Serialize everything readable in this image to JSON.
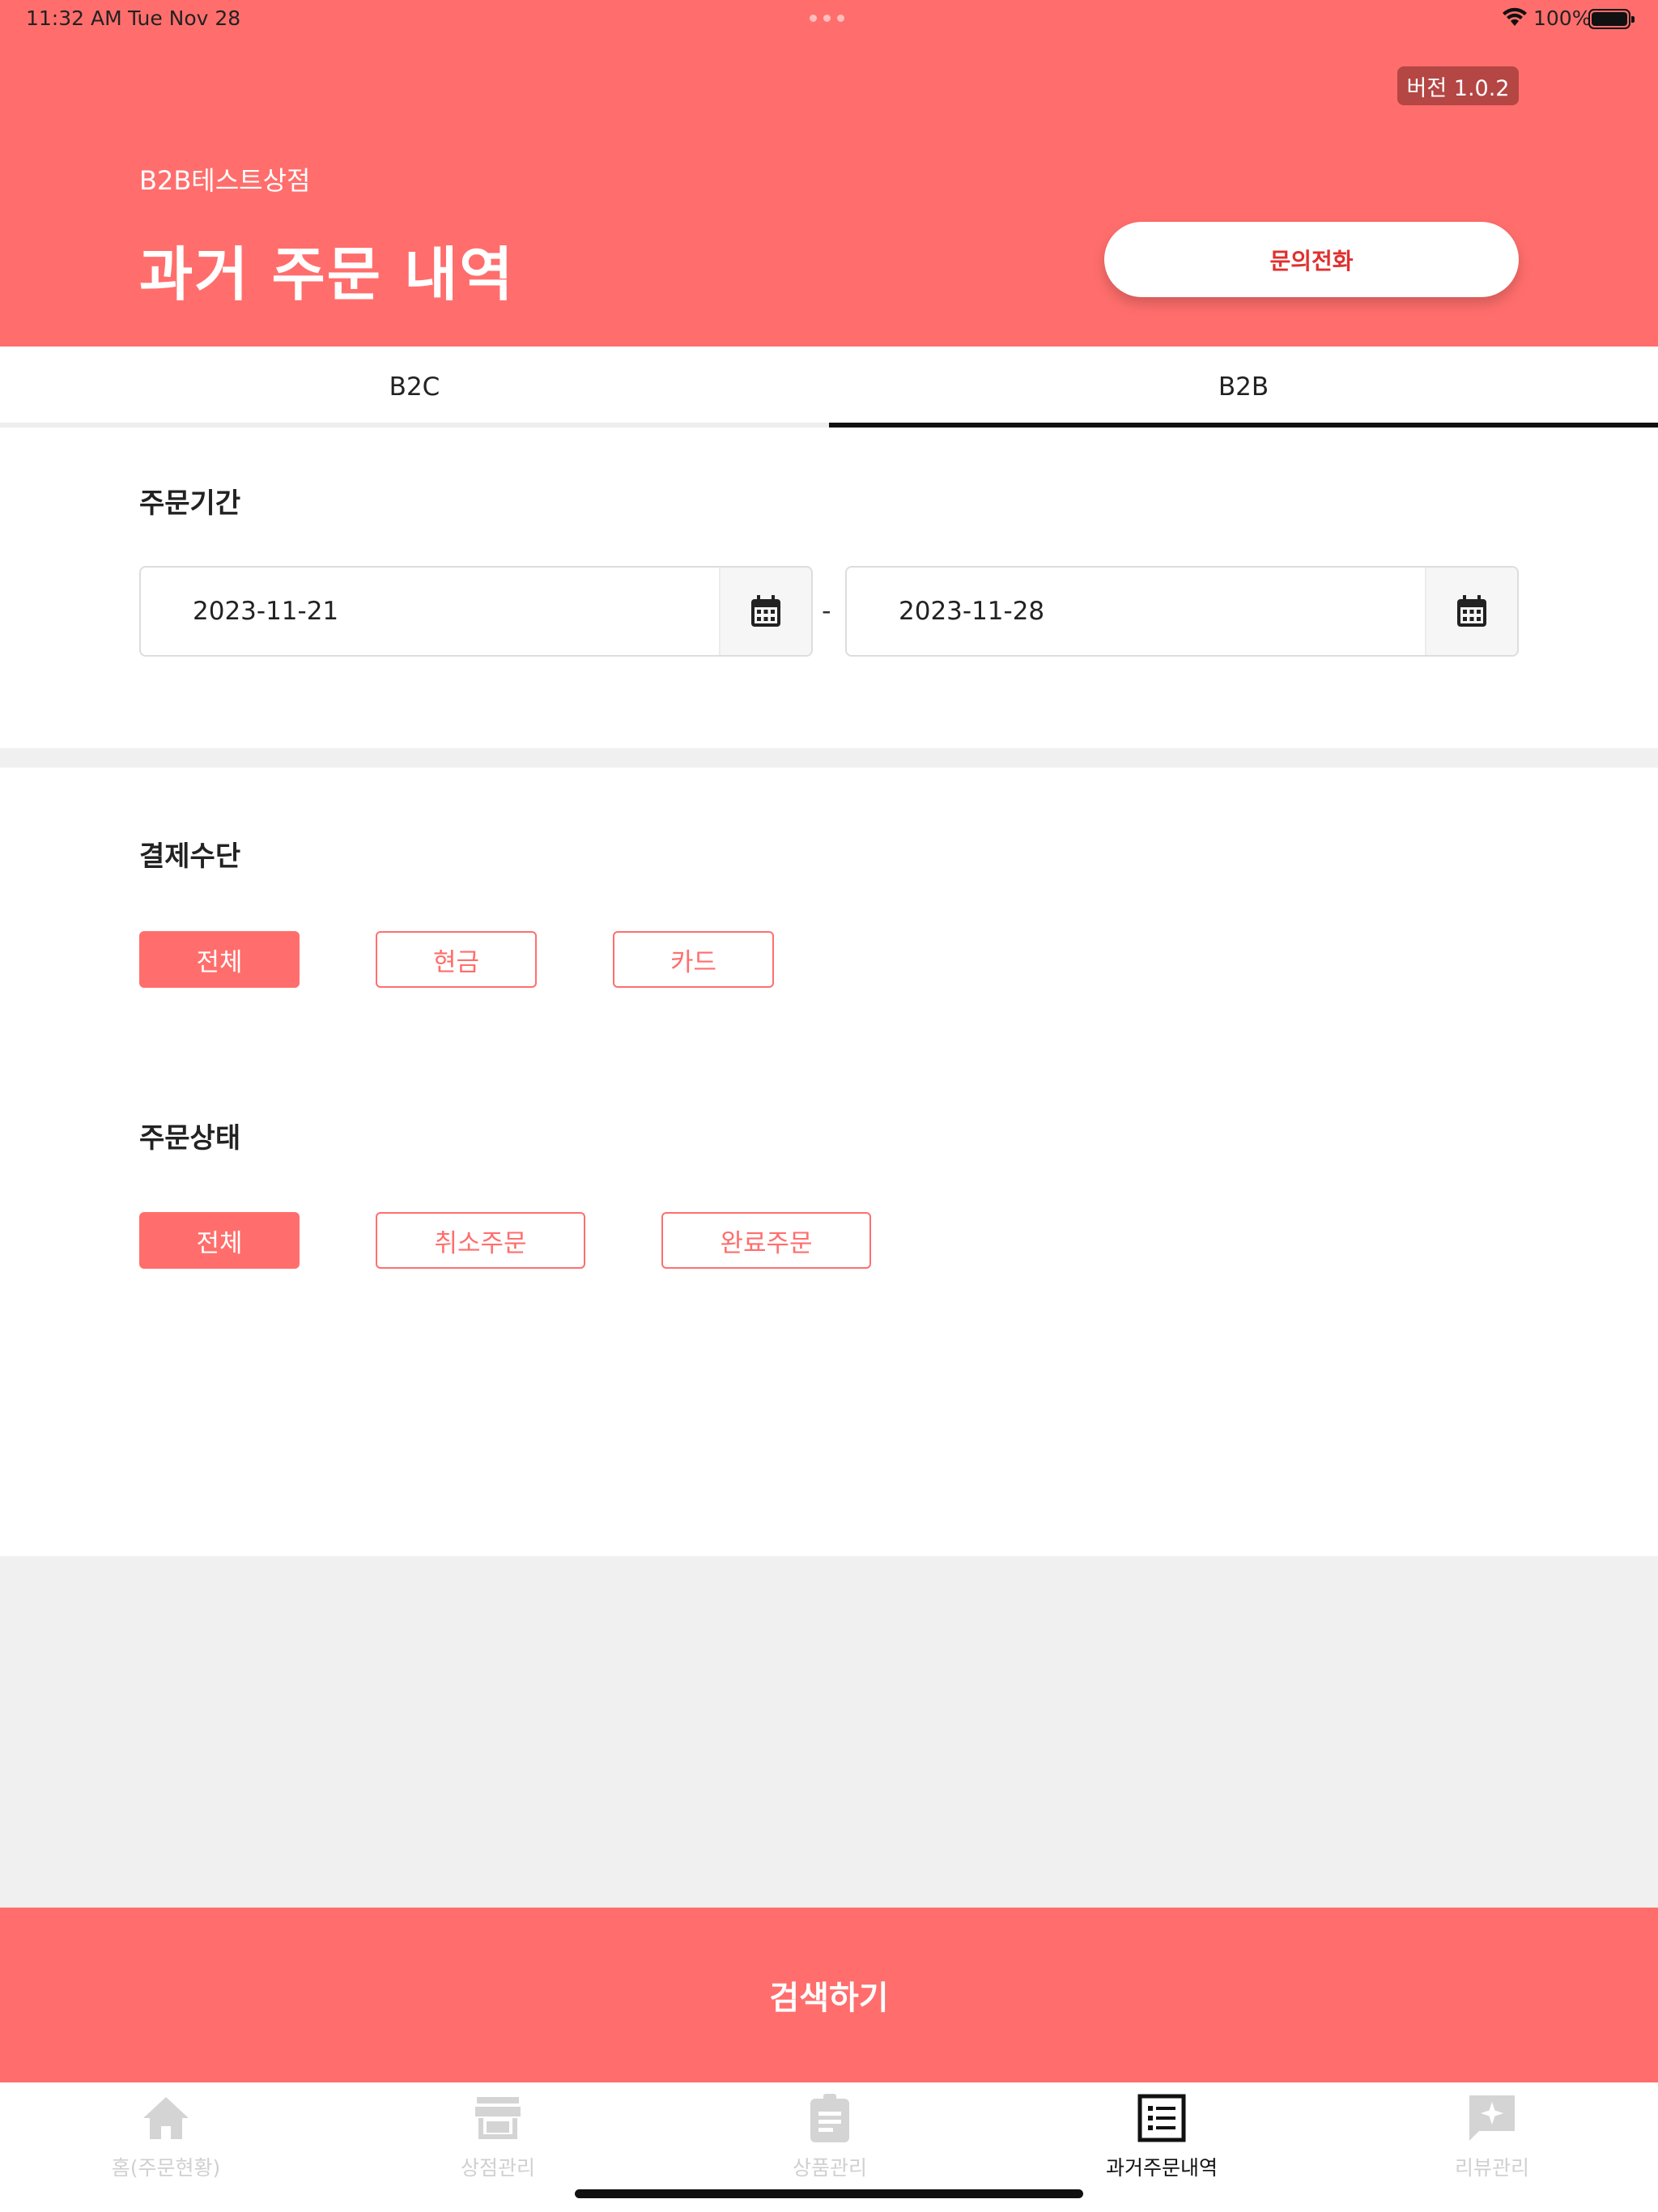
{
  "status_bar": {
    "time": "11:32 AM",
    "date": "Tue Nov 28",
    "battery": "100%"
  },
  "header": {
    "version": "버전 1.0.2",
    "store_name": "B2B테스트상점",
    "title": "과거 주문 내역",
    "call_button": "문의전화",
    "brand_color": "#ff6e6c"
  },
  "tabs": {
    "items": [
      "B2C",
      "B2B"
    ],
    "active": "B2B"
  },
  "period": {
    "label": "주문기간",
    "start_date": "2023-11-21",
    "separator": "-",
    "end_date": "2023-11-28"
  },
  "payment": {
    "label": "결제수단",
    "options": [
      "전체",
      "현금",
      "카드"
    ],
    "selected": "전체"
  },
  "status": {
    "label": "주문상태",
    "options": [
      "전체",
      "취소주문",
      "완료주문"
    ],
    "selected": "전체"
  },
  "search_button": "검색하기",
  "tab_bar": {
    "items": [
      {
        "label": "홈(주문현황)",
        "icon": "home-icon"
      },
      {
        "label": "상점관리",
        "icon": "store-icon"
      },
      {
        "label": "상품관리",
        "icon": "clipboard-icon"
      },
      {
        "label": "과거주문내역",
        "icon": "list-icon"
      },
      {
        "label": "리뷰관리",
        "icon": "review-icon"
      }
    ],
    "active_index": 3
  }
}
